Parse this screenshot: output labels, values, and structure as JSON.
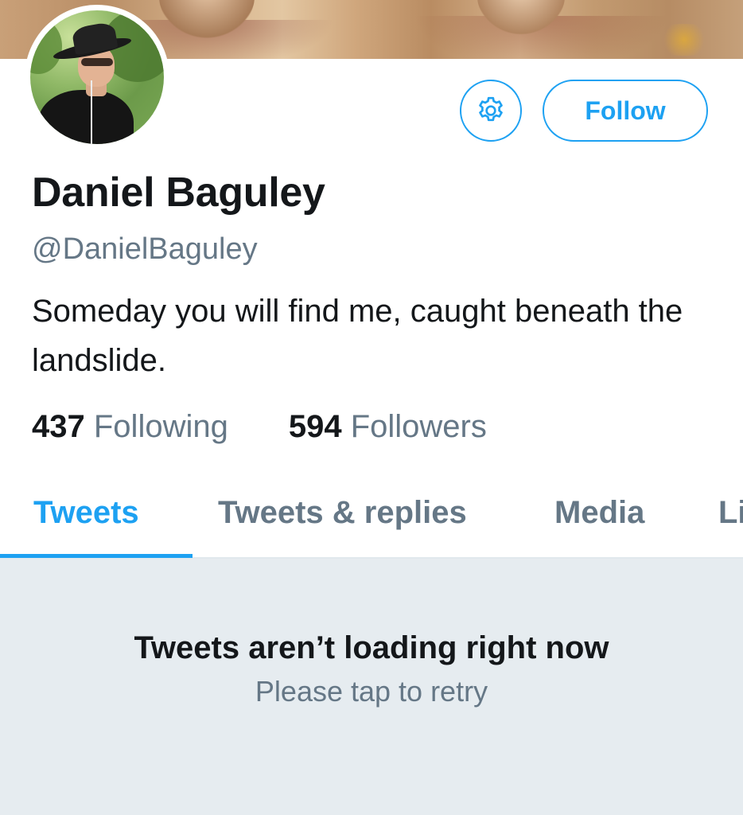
{
  "header": {
    "banner": "profile-banner-image",
    "avatar": "profile-photo"
  },
  "actions": {
    "settings_icon": "gear-icon",
    "follow_label": "Follow"
  },
  "profile": {
    "name": "Daniel Baguley",
    "handle": "@DanielBaguley",
    "bio": "Someday you will find me, caught beneath the landslide.",
    "following_count": "437",
    "following_label": "Following",
    "followers_count": "594",
    "followers_label": "Followers"
  },
  "tabs": [
    {
      "label": "Tweets",
      "active": true
    },
    {
      "label": "Tweets & replies",
      "active": false
    },
    {
      "label": "Media",
      "active": false
    },
    {
      "label": "Li",
      "active": false
    }
  ],
  "empty_state": {
    "title": "Tweets aren’t loading right now",
    "subtitle": "Please tap to retry"
  },
  "colors": {
    "accent": "#1da1f2",
    "text": "#14171a",
    "muted": "#657786",
    "empty_bg": "#e6ecf0"
  }
}
